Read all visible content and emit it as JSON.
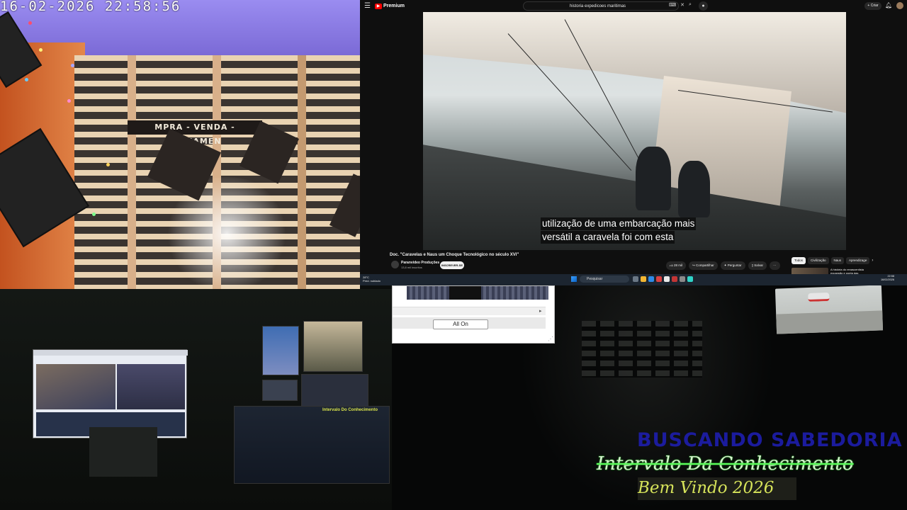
{
  "camera": {
    "timestamp": "16-02-2026  22:58:56",
    "sign_text": "MPRA - VENDA - LOTEAMEN"
  },
  "youtube": {
    "logo_label": "Premium",
    "search_query": "historia expedicoes maritimas",
    "video": {
      "subtitle_line1": "utilização de uma embarcação mais",
      "subtitle_line2": "versátil a caravela foi com esta",
      "title": "Doc. \"Caravelas e Naus um Choque Tecnológico no século XVI\"",
      "channel_name": "Paranvideo Produções",
      "channel_subs": "13,8 mil inscritos",
      "subscribe_label": "INSCREVER-SE"
    },
    "actions": {
      "like_count": "28 mil",
      "share": "Compartilhar",
      "ask": "Perguntar",
      "save": "Salvar",
      "more": "···"
    },
    "create_label": "+ Criar",
    "chips": [
      "Todos",
      "Civilização",
      "Naus",
      "Aprendizage"
    ],
    "recommendation_title": "A história do renascentista expansão e poeta das",
    "taskbar": {
      "weather_temp": "28°C",
      "weather_desc": "Pred. nublado",
      "search_label": "Pesquisar",
      "time": "22:58",
      "date": "16/02/2026"
    }
  },
  "studio": {
    "monitor_label": "Intervalo Do Conhecimento"
  },
  "app_panel": {
    "all_on_label": "All On"
  },
  "overlay": {
    "line1": "BUSCANDO SABEDORIA",
    "line2": "Intervalo Da Conhecimento",
    "line3": "Bem Vindo 2026"
  },
  "colors": {
    "overlay_line1": "#1f1fb8",
    "overlay_line2_glow": "#5cff5c",
    "overlay_line3": "#d6e35a",
    "youtube_bg": "#0f0f0f",
    "youtube_red": "#ff0000"
  }
}
